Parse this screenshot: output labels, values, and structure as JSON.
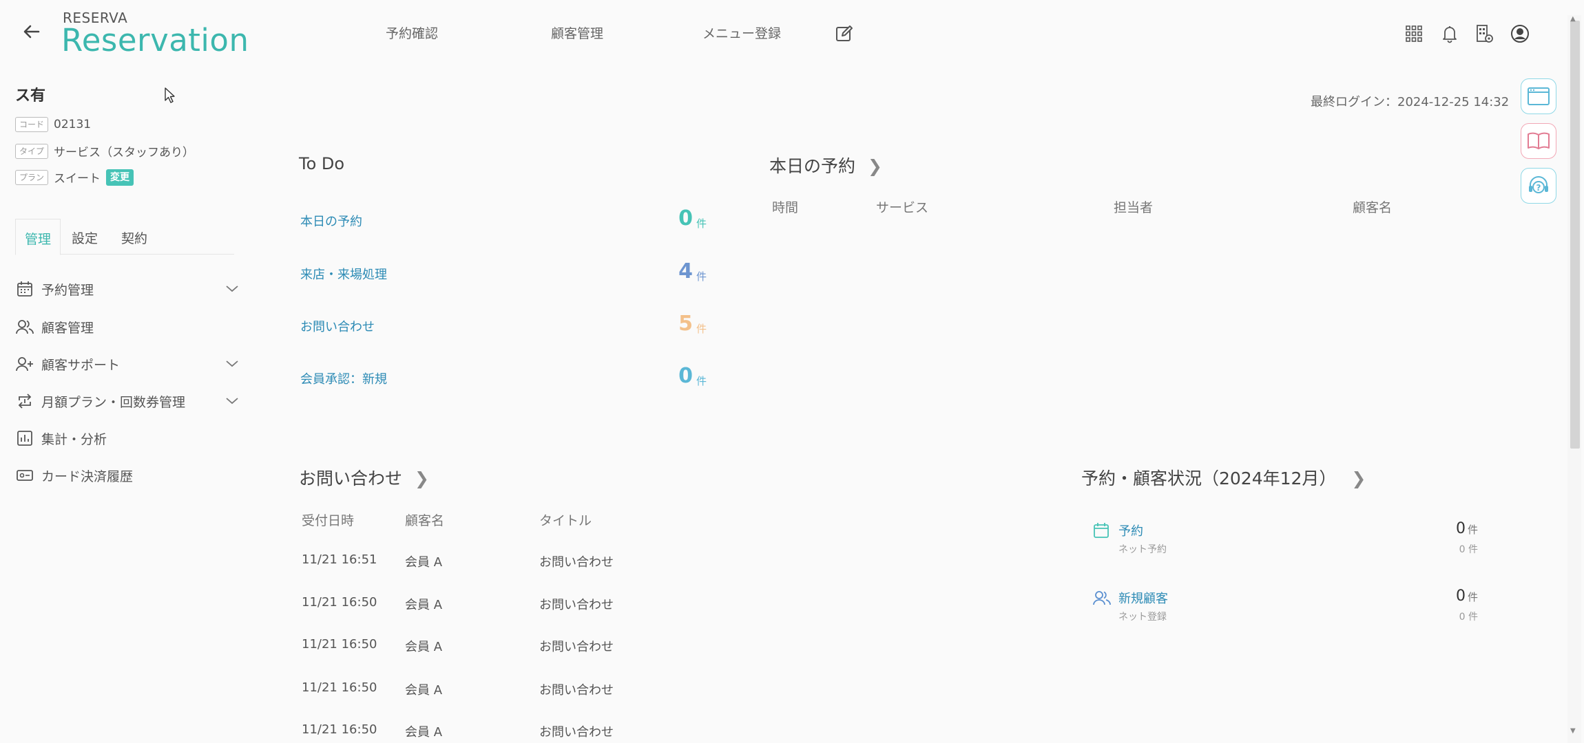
{
  "brand": {
    "top": "RESERVA",
    "main": "Reservation"
  },
  "nav": {
    "confirm": "予約確認",
    "customer": "顧客管理",
    "menu": "メニュー登録"
  },
  "last_login": "最終ログイン：2024-12-25 14:32",
  "store": {
    "name": "ス有",
    "code_tag": "コード",
    "code": "02131",
    "type_tag": "タイプ",
    "type": "サービス（スタッフあり）",
    "plan_tag": "プラン",
    "plan": "スイート",
    "change": "変更"
  },
  "side_tabs": [
    "管理",
    "設定",
    "契約"
  ],
  "sidebar": [
    {
      "label": "予約管理",
      "icon": "calendar-icon"
    },
    {
      "label": "顧客管理",
      "icon": "users-icon"
    },
    {
      "label": "顧客サポート",
      "icon": "user-plus-icon"
    },
    {
      "label": "月額プラン・回数券管理",
      "icon": "repeat-icon"
    },
    {
      "label": "集計・分析",
      "icon": "bar-chart-icon"
    },
    {
      "label": "カード決済履歴",
      "icon": "card-icon"
    }
  ],
  "todo": {
    "title": "To Do",
    "unit": "件",
    "items": [
      {
        "label": "本日の予約",
        "value": "0",
        "color": "#46c3b6"
      },
      {
        "label": "来店・来場処理",
        "value": "4",
        "color": "#6d95d0"
      },
      {
        "label": "お問い合わせ",
        "value": "5",
        "color": "#f3c08a"
      },
      {
        "label": "会員承認：新規",
        "value": "0",
        "color": "#5ab7d6"
      }
    ]
  },
  "today": {
    "title": "本日の予約",
    "headers": [
      "時間",
      "サービス",
      "担当者",
      "顧客名"
    ]
  },
  "inquiries": {
    "title": "お問い合わせ",
    "headers": [
      "受付日時",
      "顧客名",
      "タイトル"
    ],
    "rows": [
      [
        "11/21 16:51",
        "会員 A",
        "お問い合わせ"
      ],
      [
        "11/21 16:50",
        "会員 A",
        "お問い合わせ"
      ],
      [
        "11/21 16:50",
        "会員 A",
        "お問い合わせ"
      ],
      [
        "11/21 16:50",
        "会員 A",
        "お問い合わせ"
      ],
      [
        "11/21 16:50",
        "会員 A",
        "お問い合わせ"
      ]
    ]
  },
  "status": {
    "title": "予約・顧客状況（2024年12月）",
    "rows": [
      {
        "label": "予約",
        "sub": "ネット予約",
        "value": "0",
        "unit": "件",
        "sub_value": "0 件"
      },
      {
        "label": "新規顧客",
        "sub": "ネット登録",
        "value": "0",
        "unit": "件",
        "sub_value": "0 件"
      }
    ]
  }
}
